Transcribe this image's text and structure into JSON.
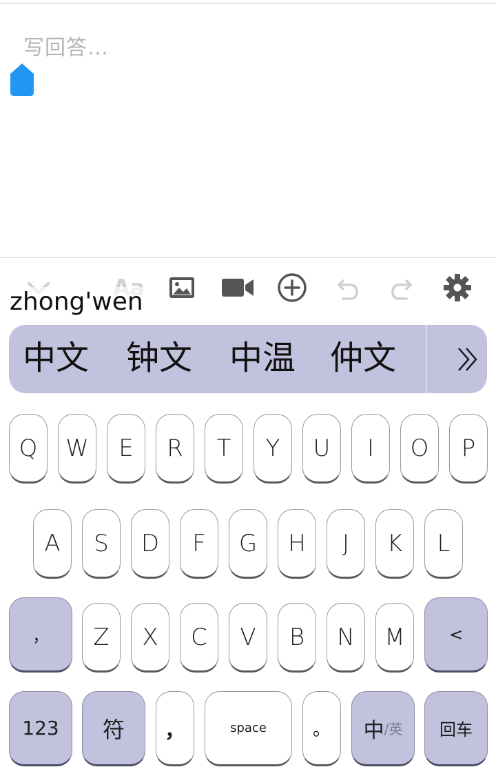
{
  "editor": {
    "placeholder": "写回答…"
  },
  "toolbar": {
    "items": [
      "chevron-down",
      "text-format",
      "image",
      "video",
      "add",
      "undo",
      "redo",
      "settings"
    ],
    "text_format_label": "Aa"
  },
  "ime": {
    "composition": "zhong'wen",
    "candidates": [
      "中文",
      "钟文",
      "中温",
      "仲文"
    ],
    "expand_label": "»"
  },
  "keyboard": {
    "row1": [
      "Q",
      "W",
      "E",
      "R",
      "T",
      "Y",
      "U",
      "I",
      "O",
      "P"
    ],
    "row2": [
      "A",
      "S",
      "D",
      "F",
      "G",
      "H",
      "J",
      "K",
      "L"
    ],
    "row3": {
      "left": "，",
      "letters": [
        "Z",
        "X",
        "C",
        "V",
        "B",
        "N",
        "M"
      ],
      "backspace": "<"
    },
    "row4": {
      "numbers": "123",
      "symbols": "符",
      "comma": "，",
      "space": "space",
      "period": "。",
      "lang_primary": "中",
      "lang_secondary": "/英",
      "enter": "回车"
    }
  },
  "colors": {
    "accent_blue": "#2196f3",
    "key_function_bg": "#c2c2de",
    "icon_dark": "#555555",
    "icon_disabled": "#d0d0d0"
  }
}
